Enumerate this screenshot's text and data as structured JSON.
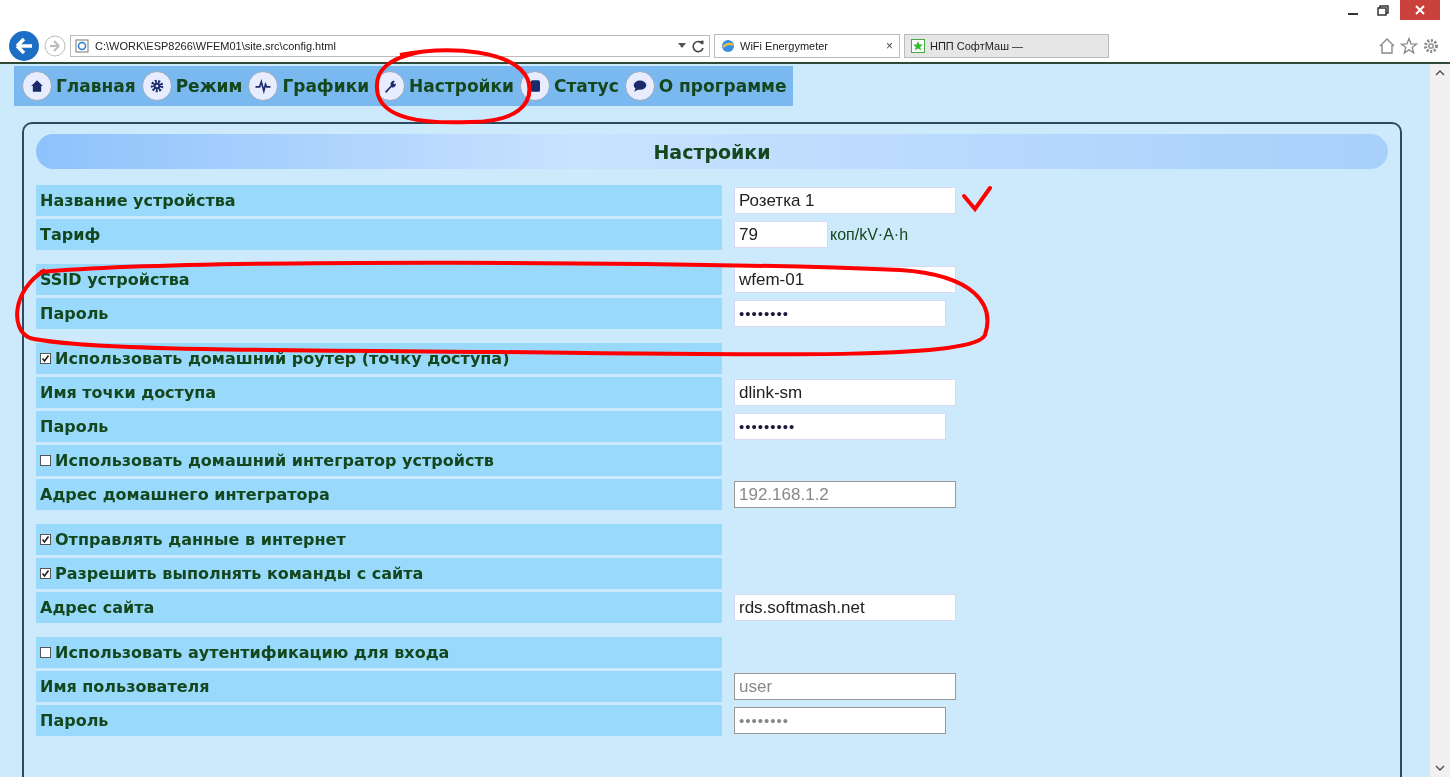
{
  "browser": {
    "address": "C:\\WORK\\ESP8266\\WFEM01\\site.src\\config.html",
    "tabs": [
      {
        "label": "WiFi Energymeter",
        "selected": true,
        "close": "×"
      },
      {
        "label": "НПП СофтМаш —",
        "selected": false
      }
    ]
  },
  "nav": [
    {
      "label": "Главная"
    },
    {
      "label": "Режим"
    },
    {
      "label": "Графики"
    },
    {
      "label": "Настройки"
    },
    {
      "label": "Статус"
    },
    {
      "label": "О программе"
    }
  ],
  "panel": {
    "title": "Настройки",
    "groups": [
      [
        {
          "kind": "text",
          "label": "Название устройства",
          "value": "Розетка 1",
          "disabled": false
        },
        {
          "kind": "number",
          "label": "Тариф",
          "value": "79",
          "unit": "коп/kV·A·h",
          "disabled": false
        }
      ],
      [
        {
          "kind": "text",
          "label": "SSID устройства",
          "value": "wfem-01",
          "disabled": false
        },
        {
          "kind": "password",
          "label": "Пароль",
          "value": "••••••••",
          "disabled": false
        }
      ],
      [
        {
          "kind": "checkbox",
          "label": "Использовать домашний роутер (точку доступа)",
          "checked": true
        },
        {
          "kind": "text",
          "label": "Имя точки доступа",
          "value": "dlink-sm",
          "disabled": false
        },
        {
          "kind": "password",
          "label": "Пароль",
          "value": "•••••••••",
          "disabled": false
        },
        {
          "kind": "checkbox",
          "label": "Использовать домашний интегратор устройств",
          "checked": false
        },
        {
          "kind": "text",
          "label": "Адрес домашнего интегратора",
          "value": "192.168.1.2",
          "disabled": true
        }
      ],
      [
        {
          "kind": "checkbox",
          "label": "Отправлять данные в интернет",
          "checked": true
        },
        {
          "kind": "checkbox",
          "label": "Разрешить выполнять команды с сайта",
          "checked": true
        },
        {
          "kind": "text",
          "label": "Адрес сайта",
          "value": "rds.softmash.net",
          "disabled": false
        }
      ],
      [
        {
          "kind": "checkbox",
          "label": "Использовать аутентификацию для входа",
          "checked": false
        },
        {
          "kind": "text",
          "label": "Имя пользователя",
          "value": "user",
          "disabled": true
        },
        {
          "kind": "password",
          "label": "Пароль",
          "value": "••••••••",
          "disabled": true
        }
      ]
    ]
  }
}
